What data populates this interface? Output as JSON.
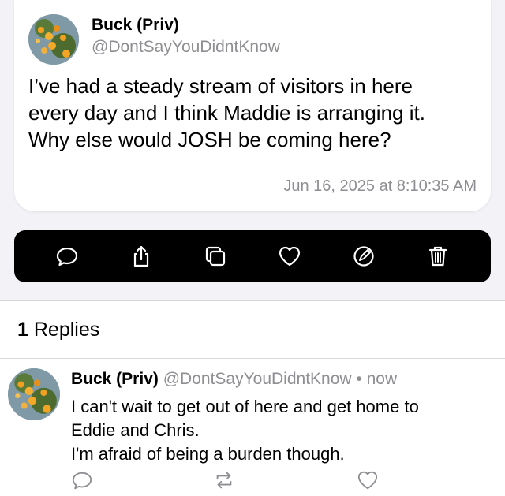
{
  "post": {
    "author_name": "Buck (Priv)",
    "author_handle": "@DontSayYouDidntKnow",
    "body_lines": [
      "I’ve had a steady stream of visitors in here",
      "every day and I think Maddie is arranging it.",
      "Why else would JOSH be coming here?"
    ],
    "timestamp": "Jun 16, 2025 at 8:10:35 AM"
  },
  "action_bar": {
    "icons": [
      "reply-icon",
      "share-icon",
      "copy-icon",
      "like-icon",
      "edit-icon",
      "delete-icon"
    ],
    "background": "#000000",
    "icon_color": "#ffffff"
  },
  "replies": {
    "count": "1",
    "label": "Replies"
  },
  "reply": {
    "author_name": "Buck (Priv)",
    "author_handle": "@DontSayYouDidntKnow",
    "separator": "•",
    "time": "now",
    "body_lines": [
      "I can't wait to get out of here and get home to",
      "Eddie and Chris.",
      "I'm afraid of being a burden though."
    ],
    "icons": [
      "reply-icon",
      "repost-icon",
      "like-icon"
    ]
  },
  "colors": {
    "secondary_text": "#8e8e93",
    "page_background": "#f2f2f7"
  }
}
